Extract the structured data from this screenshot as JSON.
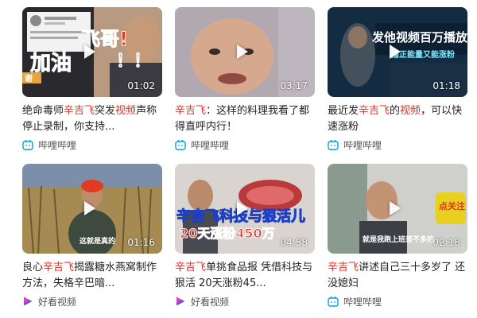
{
  "videos": [
    {
      "title_parts": [
        {
          "text": "绝命毒师",
          "hl": false
        },
        {
          "text": "辛吉飞",
          "hl": true
        },
        {
          "text": "突发",
          "hl": false
        },
        {
          "text": "视频",
          "hl": true
        },
        {
          "text": "声称停止录制，你支持...",
          "hl": false
        }
      ],
      "duration": "01:02",
      "source": "哔哩哔哩",
      "source_icon": "bilibili-icon",
      "overlay": [
        "飞哥!",
        "加油",
        "！！",
        "谢"
      ]
    },
    {
      "title_parts": [
        {
          "text": "辛吉飞",
          "hl": true
        },
        {
          "text": "：这样的料理我看了都得直呼内行！",
          "hl": false
        }
      ],
      "duration": "03:17",
      "source": "哔哩哔哩",
      "source_icon": "bilibili-icon",
      "overlay": []
    },
    {
      "title_parts": [
        {
          "text": "最近发",
          "hl": false
        },
        {
          "text": "辛吉飞",
          "hl": true
        },
        {
          "text": "的",
          "hl": false
        },
        {
          "text": "视频",
          "hl": true
        },
        {
          "text": "，可以快速涨粉",
          "hl": false
        }
      ],
      "duration": "01:18",
      "source": "哔哩哔哩",
      "source_icon": "bilibili-icon",
      "overlay": [
        "发他视频百万播放",
        "播正能量又能涨粉"
      ]
    },
    {
      "title_parts": [
        {
          "text": "良心",
          "hl": false
        },
        {
          "text": "辛吉飞",
          "hl": true
        },
        {
          "text": "揭露糖水燕窝制作方法，失格辛巴暗...",
          "hl": false
        }
      ],
      "duration": "01:16",
      "source": "好看视频",
      "source_icon": "haokan-icon",
      "overlay": [
        "这就是真的"
      ]
    },
    {
      "title_parts": [
        {
          "text": "辛吉飞",
          "hl": true
        },
        {
          "text": "单挑食品报 凭借科技与狠活 20天涨粉45...",
          "hl": false
        }
      ],
      "duration": "04:58",
      "source": "好看视频",
      "source_icon": "haokan-icon",
      "overlay": [
        "辛吉飞科技与狠活儿",
        "20天涨粉450万"
      ]
    },
    {
      "title_parts": [
        {
          "text": "辛吉飞",
          "hl": true
        },
        {
          "text": "讲述自己三十多岁了 还没媳妇",
          "hl": false
        }
      ],
      "duration": "02:18",
      "source": "哔哩哔哩",
      "source_icon": "bilibili-icon",
      "overlay": [
        "点关注",
        "就是我跑上班差不多的"
      ]
    }
  ],
  "colors": {
    "highlight": "#e02e24",
    "bilibili": "#00a1d6",
    "haokan_pink": "#e2489a",
    "haokan_purple": "#7b4ae0"
  }
}
